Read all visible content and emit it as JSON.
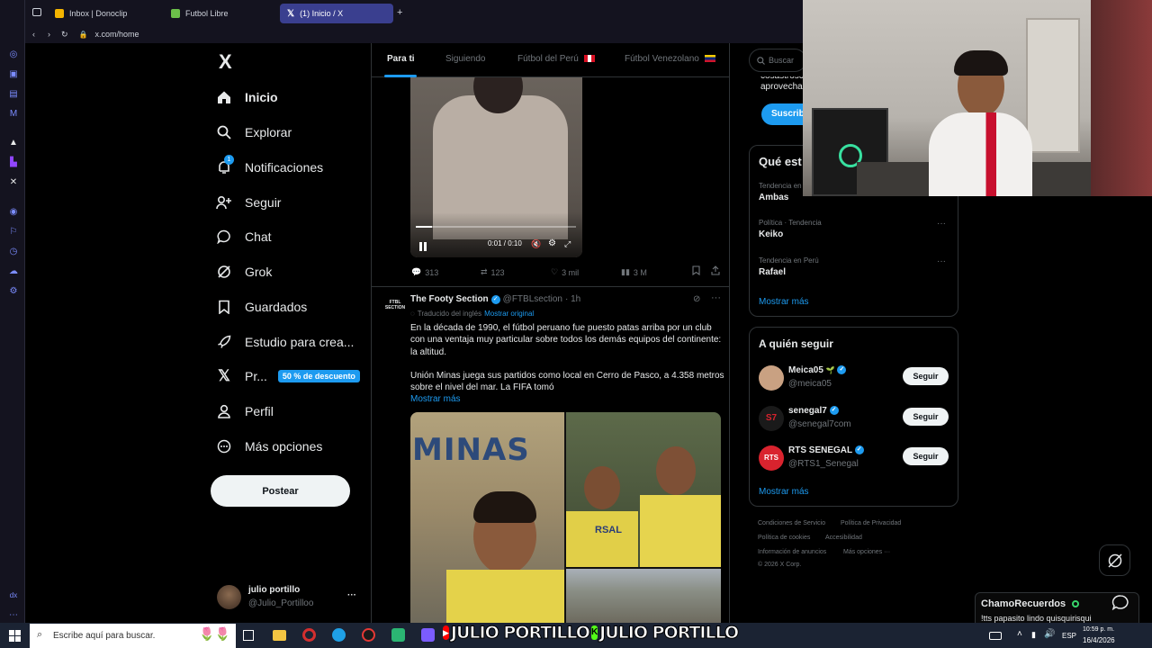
{
  "browser": {
    "tabs": [
      {
        "title": "Inbox | Donoclip",
        "color": "#f4b400"
      },
      {
        "title": "Futbol Libre",
        "color": "#6cc04a"
      },
      {
        "title": "(1) Inicio / X",
        "color": "#ffffff"
      }
    ],
    "new_tab_label": "+",
    "url": "x.com/home"
  },
  "nav": {
    "logo": "X",
    "items": [
      {
        "label": "Inicio",
        "icon": "home-icon"
      },
      {
        "label": "Explorar",
        "icon": "search-icon"
      },
      {
        "label": "Notificaciones",
        "icon": "bell-icon",
        "badge": "1"
      },
      {
        "label": "Seguir",
        "icon": "add-person-icon"
      },
      {
        "label": "Chat",
        "icon": "chat-icon"
      },
      {
        "label": "Grok",
        "icon": "grok-icon"
      },
      {
        "label": "Guardados",
        "icon": "bookmark-icon"
      },
      {
        "label": "Estudio para crea...",
        "icon": "rocket-icon"
      },
      {
        "label": "Pr...",
        "icon": "x-icon",
        "badge": "50 % de descuento"
      },
      {
        "label": "Perfil",
        "icon": "person-icon"
      },
      {
        "label": "Más opciones",
        "icon": "more-icon"
      }
    ],
    "post_label": "Postear",
    "account": {
      "name": "julio portillo",
      "handle": "@Julio_Portilloo",
      "more": "···"
    }
  },
  "feed": {
    "tabs": [
      "Para ti",
      "Siguiendo",
      "Fútbol del Perú",
      "Fútbol Venezolano"
    ],
    "video": {
      "time": "0:01 / 0:10",
      "progress": 0.1
    },
    "tweet1_metrics": {
      "replies": "313",
      "reposts": "123",
      "likes": "3 mil",
      "views": "3 M"
    },
    "tweet2": {
      "author": "The Footy Section",
      "handle": "@FTBLsection",
      "time": "· 1h",
      "avatar_text": "FTBL SECTION",
      "translated": "Traducido del inglés",
      "show_original": "Mostrar original",
      "text_p1": "En la década de 1990, el fútbol peruano fue puesto patas arriba por un club con una ventaja muy particular sobre todos los demás equipos del continente: la altitud.",
      "text_p2": "Unión Minas juega sus partidos como local en Cerro de Pasco, a 4.358 metros sobre el nivel del mar. La FIFA tomó",
      "show_more": "Mostrar más",
      "image_text": "MINAS",
      "jersey_text": "RSAL"
    }
  },
  "right": {
    "search_placeholder": "Buscar",
    "premium": {
      "line1": "cosastrosca",
      "line2": "aprovecha",
      "button": "Suscrib"
    },
    "trends_title": "Qué est",
    "trends": [
      {
        "meta": "Tendencia en",
        "name": "Ambas"
      },
      {
        "meta": "Política · Tendencia",
        "name": "Keiko"
      },
      {
        "meta": "Tendencia en Perú",
        "name": "Rafael"
      }
    ],
    "trends_more": "Mostrar más",
    "follow_title": "A quién seguir",
    "follow": [
      {
        "name": "Meica05",
        "handle": "@meica05",
        "button": "Seguir",
        "color": "#c9a182",
        "extra": "🌱"
      },
      {
        "name": "senegal7",
        "handle": "@senegal7com",
        "button": "Seguir",
        "color": "#1a1a1a",
        "extra": ""
      },
      {
        "name": "RTS SENEGAL",
        "handle": "@RTS1_Senegal",
        "button": "Seguir",
        "color": "#d9232e",
        "extra": ""
      }
    ],
    "follow_more": "Mostrar más",
    "footer": [
      "Condiciones de Servicio",
      "Política de Privacidad",
      "Política de cookies",
      "Accesibilidad",
      "Información de anuncios",
      "Más opciones ···",
      "© 2026 X Corp."
    ]
  },
  "overlay": {
    "chat_user": "ChamoRecuerdos",
    "chat_message": "!tts papasito lindo quisquirisqui",
    "banner": "JULIO PORTILLO",
    "banner2": "JULIO PORTILLO"
  },
  "taskbar": {
    "search_placeholder": "Escribe aquí para buscar.",
    "lang": "ESP",
    "time": "10:59 p. m.",
    "date": "16/4/2026"
  }
}
